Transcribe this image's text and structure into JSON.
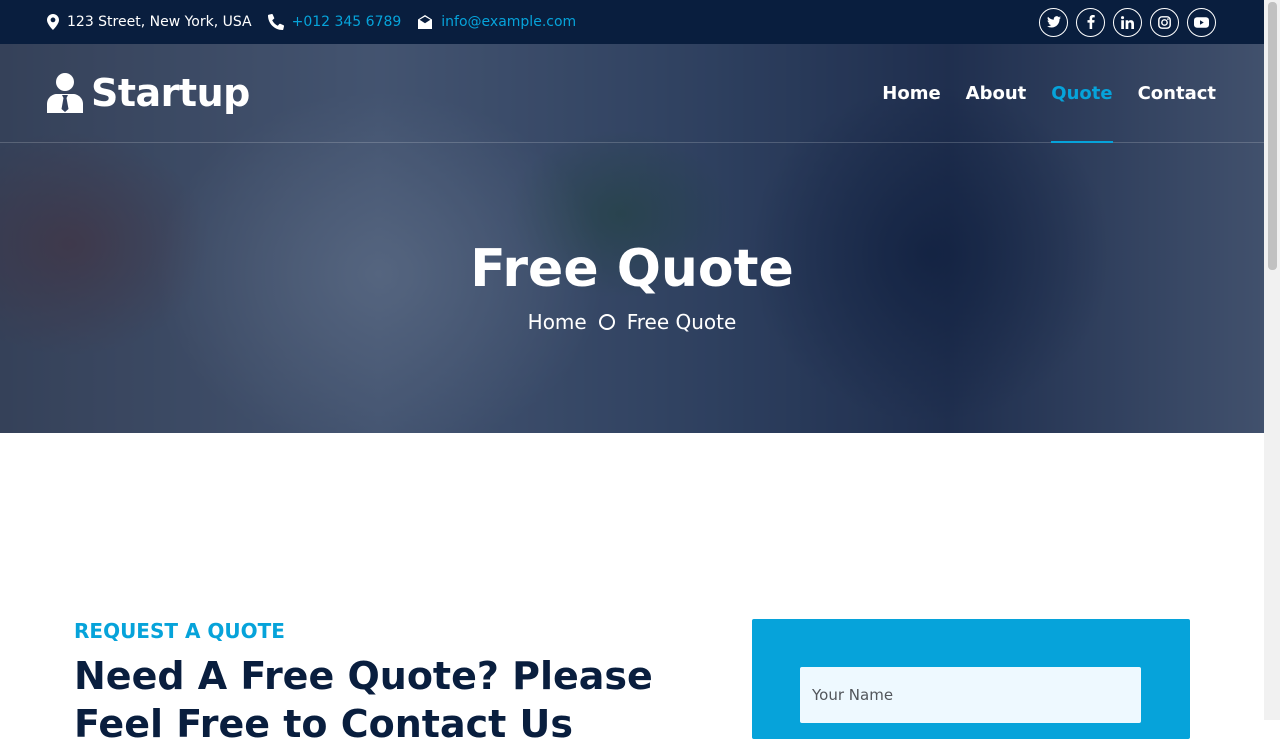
{
  "topbar": {
    "address": "123 Street, New York, USA",
    "phone": "+012 345 6789",
    "email": "info@example.com",
    "social": [
      "twitter-icon",
      "facebook-icon",
      "linkedin-icon",
      "instagram-icon",
      "youtube-icon"
    ]
  },
  "brand": {
    "name": "Startup",
    "icon": "user-tie-icon"
  },
  "nav": {
    "items": [
      {
        "label": "Home",
        "active": false
      },
      {
        "label": "About",
        "active": false
      },
      {
        "label": "Quote",
        "active": true
      },
      {
        "label": "Contact",
        "active": false
      }
    ]
  },
  "hero": {
    "title": "Free Quote",
    "breadcrumb": [
      "Home",
      "Free Quote"
    ]
  },
  "section": {
    "eyebrow": "Request A Quote",
    "title": "Need A Free Quote? Please Feel Free to Contact Us"
  },
  "form": {
    "name_placeholder": "Your Name"
  },
  "colors": {
    "primary": "#06a3da",
    "dark": "#091e3e",
    "white": "#ffffff"
  }
}
